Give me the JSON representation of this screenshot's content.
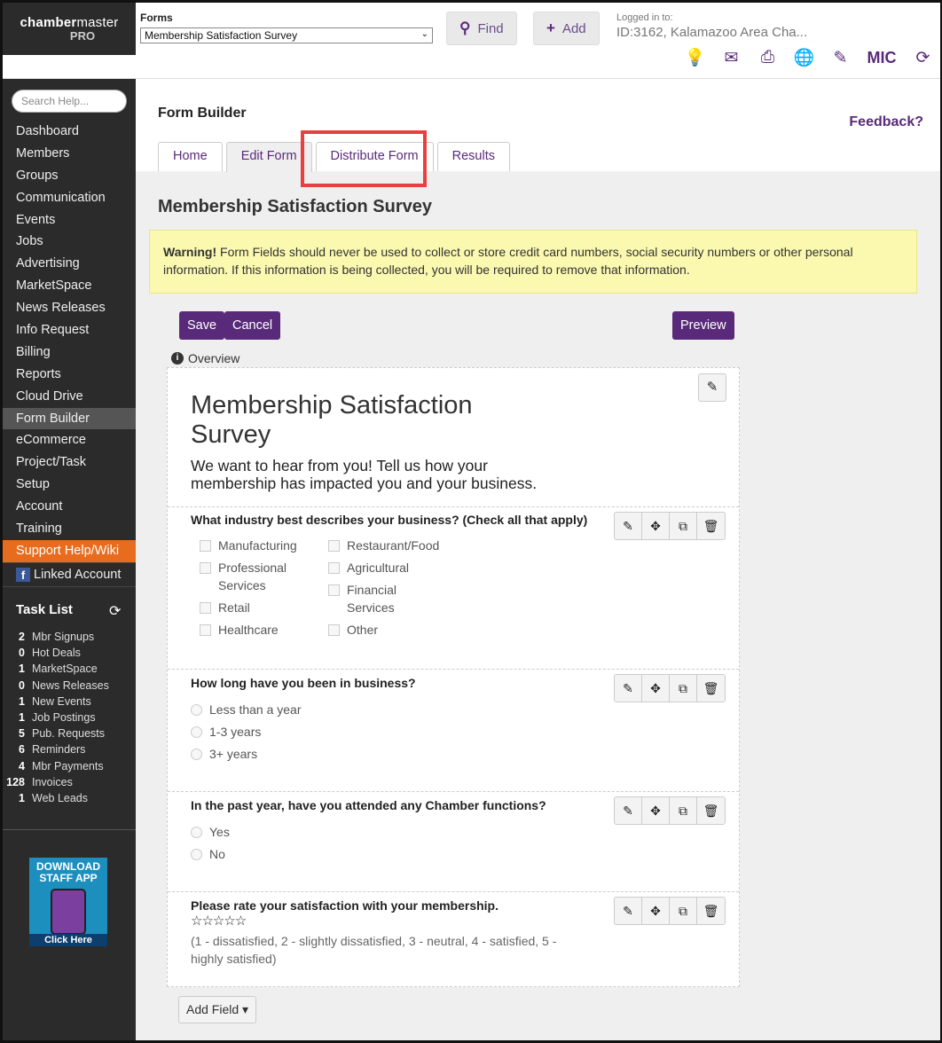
{
  "brand": {
    "name_bold": "chamber",
    "name_rest": "master",
    "tier": "PRO"
  },
  "forms_selector": {
    "label": "Forms",
    "selected": "Membership Satisfaction Survey"
  },
  "top_buttons": {
    "find": "Find",
    "add": "Add"
  },
  "login": {
    "label": "Logged in to:",
    "value": "ID:3162, Kalamazoo Area Cha..."
  },
  "top_icons": {
    "mic": "MIC"
  },
  "search": {
    "placeholder": "Search Help..."
  },
  "nav": [
    "Dashboard",
    "Members",
    "Groups",
    "Communication",
    "Events",
    "Jobs",
    "Advertising",
    "MarketSpace",
    "News Releases",
    "Info Request",
    "Billing",
    "Reports",
    "Cloud Drive",
    "Form Builder",
    "eCommerce",
    "Project/Task",
    "Setup",
    "Account",
    "Training",
    "Support Help/Wiki"
  ],
  "nav_active": "Form Builder",
  "linked_account": "Linked Account",
  "task_list": {
    "title": "Task List",
    "items": [
      {
        "count": "2",
        "label": "Mbr Signups"
      },
      {
        "count": "0",
        "label": "Hot Deals"
      },
      {
        "count": "1",
        "label": "MarketSpace"
      },
      {
        "count": "0",
        "label": "News Releases"
      },
      {
        "count": "1",
        "label": "New Events"
      },
      {
        "count": "1",
        "label": "Job Postings"
      },
      {
        "count": "5",
        "label": "Pub. Requests"
      },
      {
        "count": "6",
        "label": "Reminders"
      },
      {
        "count": "4",
        "label": "Mbr Payments"
      },
      {
        "count": "128",
        "label": "Invoices"
      },
      {
        "count": "1",
        "label": "Web Leads"
      }
    ]
  },
  "app_promo": {
    "line1": "DOWNLOAD",
    "line2": "STAFF APP",
    "cta": "Click Here"
  },
  "page": {
    "title": "Form Builder",
    "feedback": "Feedback?",
    "tabs": [
      "Home",
      "Edit Form",
      "Distribute Form",
      "Results"
    ],
    "active_tab": "Edit Form",
    "highlighted_tab": "Distribute Form",
    "survey_title": "Membership Satisfaction Survey",
    "warning_bold": "Warning!",
    "warning_text": " Form Fields should never be used to collect or store credit card numbers, social security numbers or other personal information. If this information is being collected, you will be required to remove that information.",
    "save": "Save",
    "cancel": "Cancel",
    "preview": "Preview",
    "overview": "Overview",
    "add_field": "Add Field"
  },
  "form": {
    "title": "Membership Satisfaction Survey",
    "description": "We want to hear from you! Tell us how your membership has impacted you and your business.",
    "q1": {
      "question": "What industry best describes your business? (Check all that apply)",
      "options_col1": [
        "Manufacturing",
        "Professional Services",
        "Retail",
        "Healthcare"
      ],
      "options_col2": [
        "Restaurant/Food",
        "Agricultural",
        "Financial Services",
        "Other"
      ]
    },
    "q2": {
      "question": "How long have you been in business?",
      "options": [
        "Less than a year",
        "1-3 years",
        "3+ years"
      ]
    },
    "q3": {
      "question": "In the past year, have you attended any Chamber functions?",
      "options": [
        "Yes",
        "No"
      ]
    },
    "q4": {
      "question": "Please rate your satisfaction with your membership.",
      "stars": "☆☆☆☆☆",
      "scale": "(1 - dissatisfied, 2 - slightly dissatisfied, 3 - neutral, 4 - satisfied, 5 - highly satisfied)"
    }
  },
  "colors": {
    "accent": "#5a2a7a",
    "highlight": "#e84040",
    "warning_bg": "#fbf9b0",
    "support": "#e86c1e"
  }
}
